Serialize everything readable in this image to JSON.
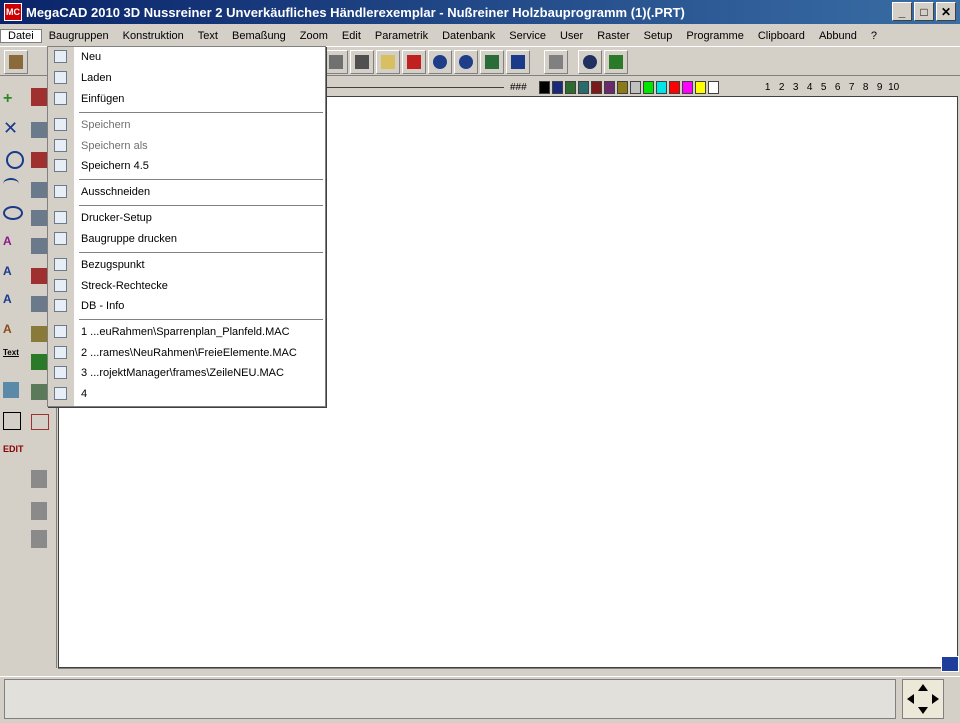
{
  "window": {
    "title": "MegaCAD 2010 3D Nussreiner 2  Unverkäufliches Händlerexemplar - Nußreiner Holzbauprogramm (1)(.PRT)",
    "app_icon_text": "MC",
    "minimize_glyph": "_",
    "maximize_glyph": "□",
    "close_glyph": "✕"
  },
  "menubar": {
    "items": [
      {
        "label": "Datei",
        "active": true
      },
      {
        "label": "Baugruppen"
      },
      {
        "label": "Konstruktion"
      },
      {
        "label": "Text"
      },
      {
        "label": "Bemaßung"
      },
      {
        "label": "Zoom"
      },
      {
        "label": "Edit"
      },
      {
        "label": "Parametrik"
      },
      {
        "label": "Datenbank"
      },
      {
        "label": "Service"
      },
      {
        "label": "User"
      },
      {
        "label": "Raster"
      },
      {
        "label": "Setup"
      },
      {
        "label": "Programme"
      },
      {
        "label": "Clipboard"
      },
      {
        "label": "Abbund"
      },
      {
        "label": "?"
      }
    ]
  },
  "colorbar": {
    "hash_label": "###",
    "swatches": [
      "#000000",
      "#1a2a7a",
      "#2e6b2e",
      "#2a6b6b",
      "#7a1a1a",
      "#6b2a6b",
      "#8a7a1a",
      "#c0c0c0",
      "#00e600",
      "#00e6e6",
      "#ff0000",
      "#ff00ff",
      "#ffff00",
      "#ffffff"
    ],
    "numbers": [
      "1",
      "2",
      "3",
      "4",
      "5",
      "6",
      "7",
      "8",
      "9",
      "10"
    ]
  },
  "dropdown": {
    "items": [
      {
        "label": "Neu",
        "enabled": true
      },
      {
        "label": "Laden",
        "enabled": true
      },
      {
        "label": "Einfügen",
        "enabled": true
      },
      {
        "label": "Speichern",
        "enabled": false
      },
      {
        "label": "Speichern als",
        "enabled": false
      },
      {
        "label": "Speichern 4.5",
        "enabled": true
      },
      {
        "label": "Ausschneiden",
        "enabled": true
      },
      {
        "label": "Drucker-Setup",
        "enabled": true
      },
      {
        "label": "Baugruppe drucken",
        "enabled": true
      },
      {
        "label": "Bezugspunkt",
        "enabled": true
      },
      {
        "label": "Streck-Rechtecke",
        "enabled": true
      },
      {
        "label": "DB - Info",
        "enabled": true
      },
      {
        "label": "1 ...euRahmen\\Sparrenplan_Planfeld.MAC",
        "enabled": true
      },
      {
        "label": "2 ...rames\\NeuRahmen\\FreieElemente.MAC",
        "enabled": true
      },
      {
        "label": "3 ...rojektManager\\frames\\ZeileNEU.MAC",
        "enabled": true
      },
      {
        "label": "4",
        "enabled": true
      }
    ]
  },
  "left_rail": {
    "edit_label": "EDIT",
    "text_label": "Text"
  }
}
